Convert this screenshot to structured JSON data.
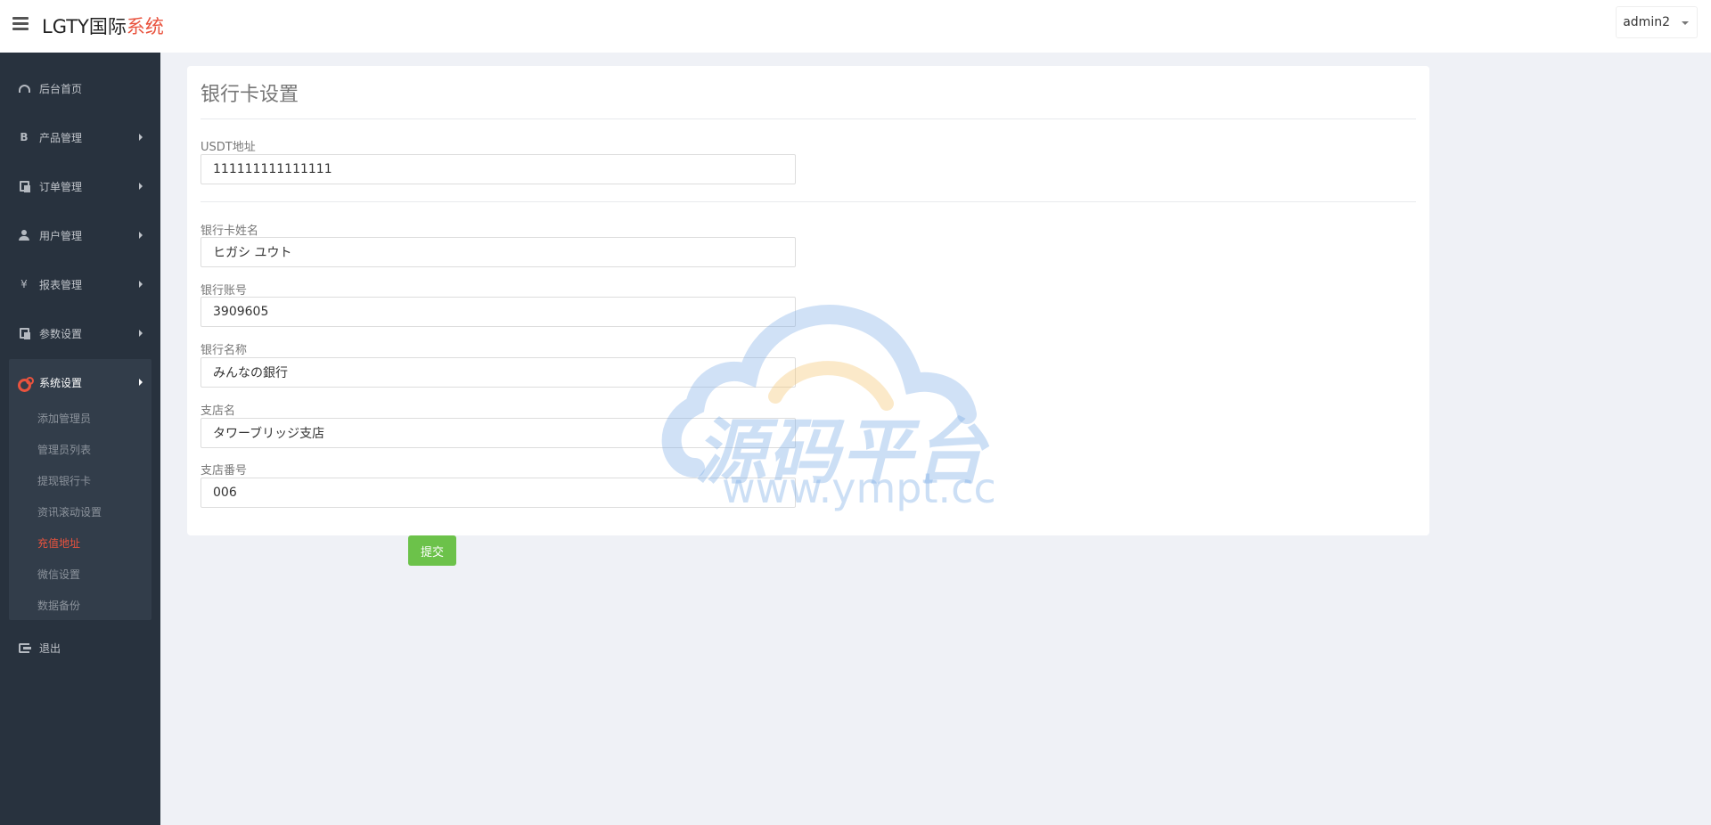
{
  "header": {
    "brand_main": "LGTY国际",
    "brand_accent": "系统",
    "user": "admin2"
  },
  "sidebar": {
    "items": [
      {
        "label": "后台首页",
        "icon": "dashboard-icon"
      },
      {
        "label": "产品管理",
        "icon": "bitcoin-icon"
      },
      {
        "label": "订单管理",
        "icon": "copy-icon"
      },
      {
        "label": "用户管理",
        "icon": "user-icon"
      },
      {
        "label": "报表管理",
        "icon": "yen-icon"
      },
      {
        "label": "参数设置",
        "icon": "copy-icon"
      },
      {
        "label": "系统设置",
        "icon": "cogs-icon"
      },
      {
        "label": "退出",
        "icon": "sign-out-icon"
      }
    ],
    "sub_items": [
      {
        "label": "添加管理员"
      },
      {
        "label": "管理员列表"
      },
      {
        "label": "提现银行卡"
      },
      {
        "label": "资讯滚动设置"
      },
      {
        "label": "充值地址"
      },
      {
        "label": "微信设置"
      },
      {
        "label": "数据备份"
      }
    ],
    "accent_color": "#e9533e"
  },
  "panel": {
    "title": "银行卡设置",
    "fields": [
      {
        "label": "USDT地址",
        "value": "111111111111111"
      },
      {
        "label": "银行卡姓名",
        "value": "ヒガシ ユウト"
      },
      {
        "label": "银行账号",
        "value": "3909605"
      },
      {
        "label": "银行名称",
        "value": "みんなの銀行"
      },
      {
        "label": "支店名",
        "value": "タワーブリッジ支店"
      },
      {
        "label": "支店番号",
        "value": "006"
      }
    ],
    "submit_label": "提交"
  },
  "watermark": {
    "text": "源码平台",
    "url": "www.ympt.cc"
  }
}
